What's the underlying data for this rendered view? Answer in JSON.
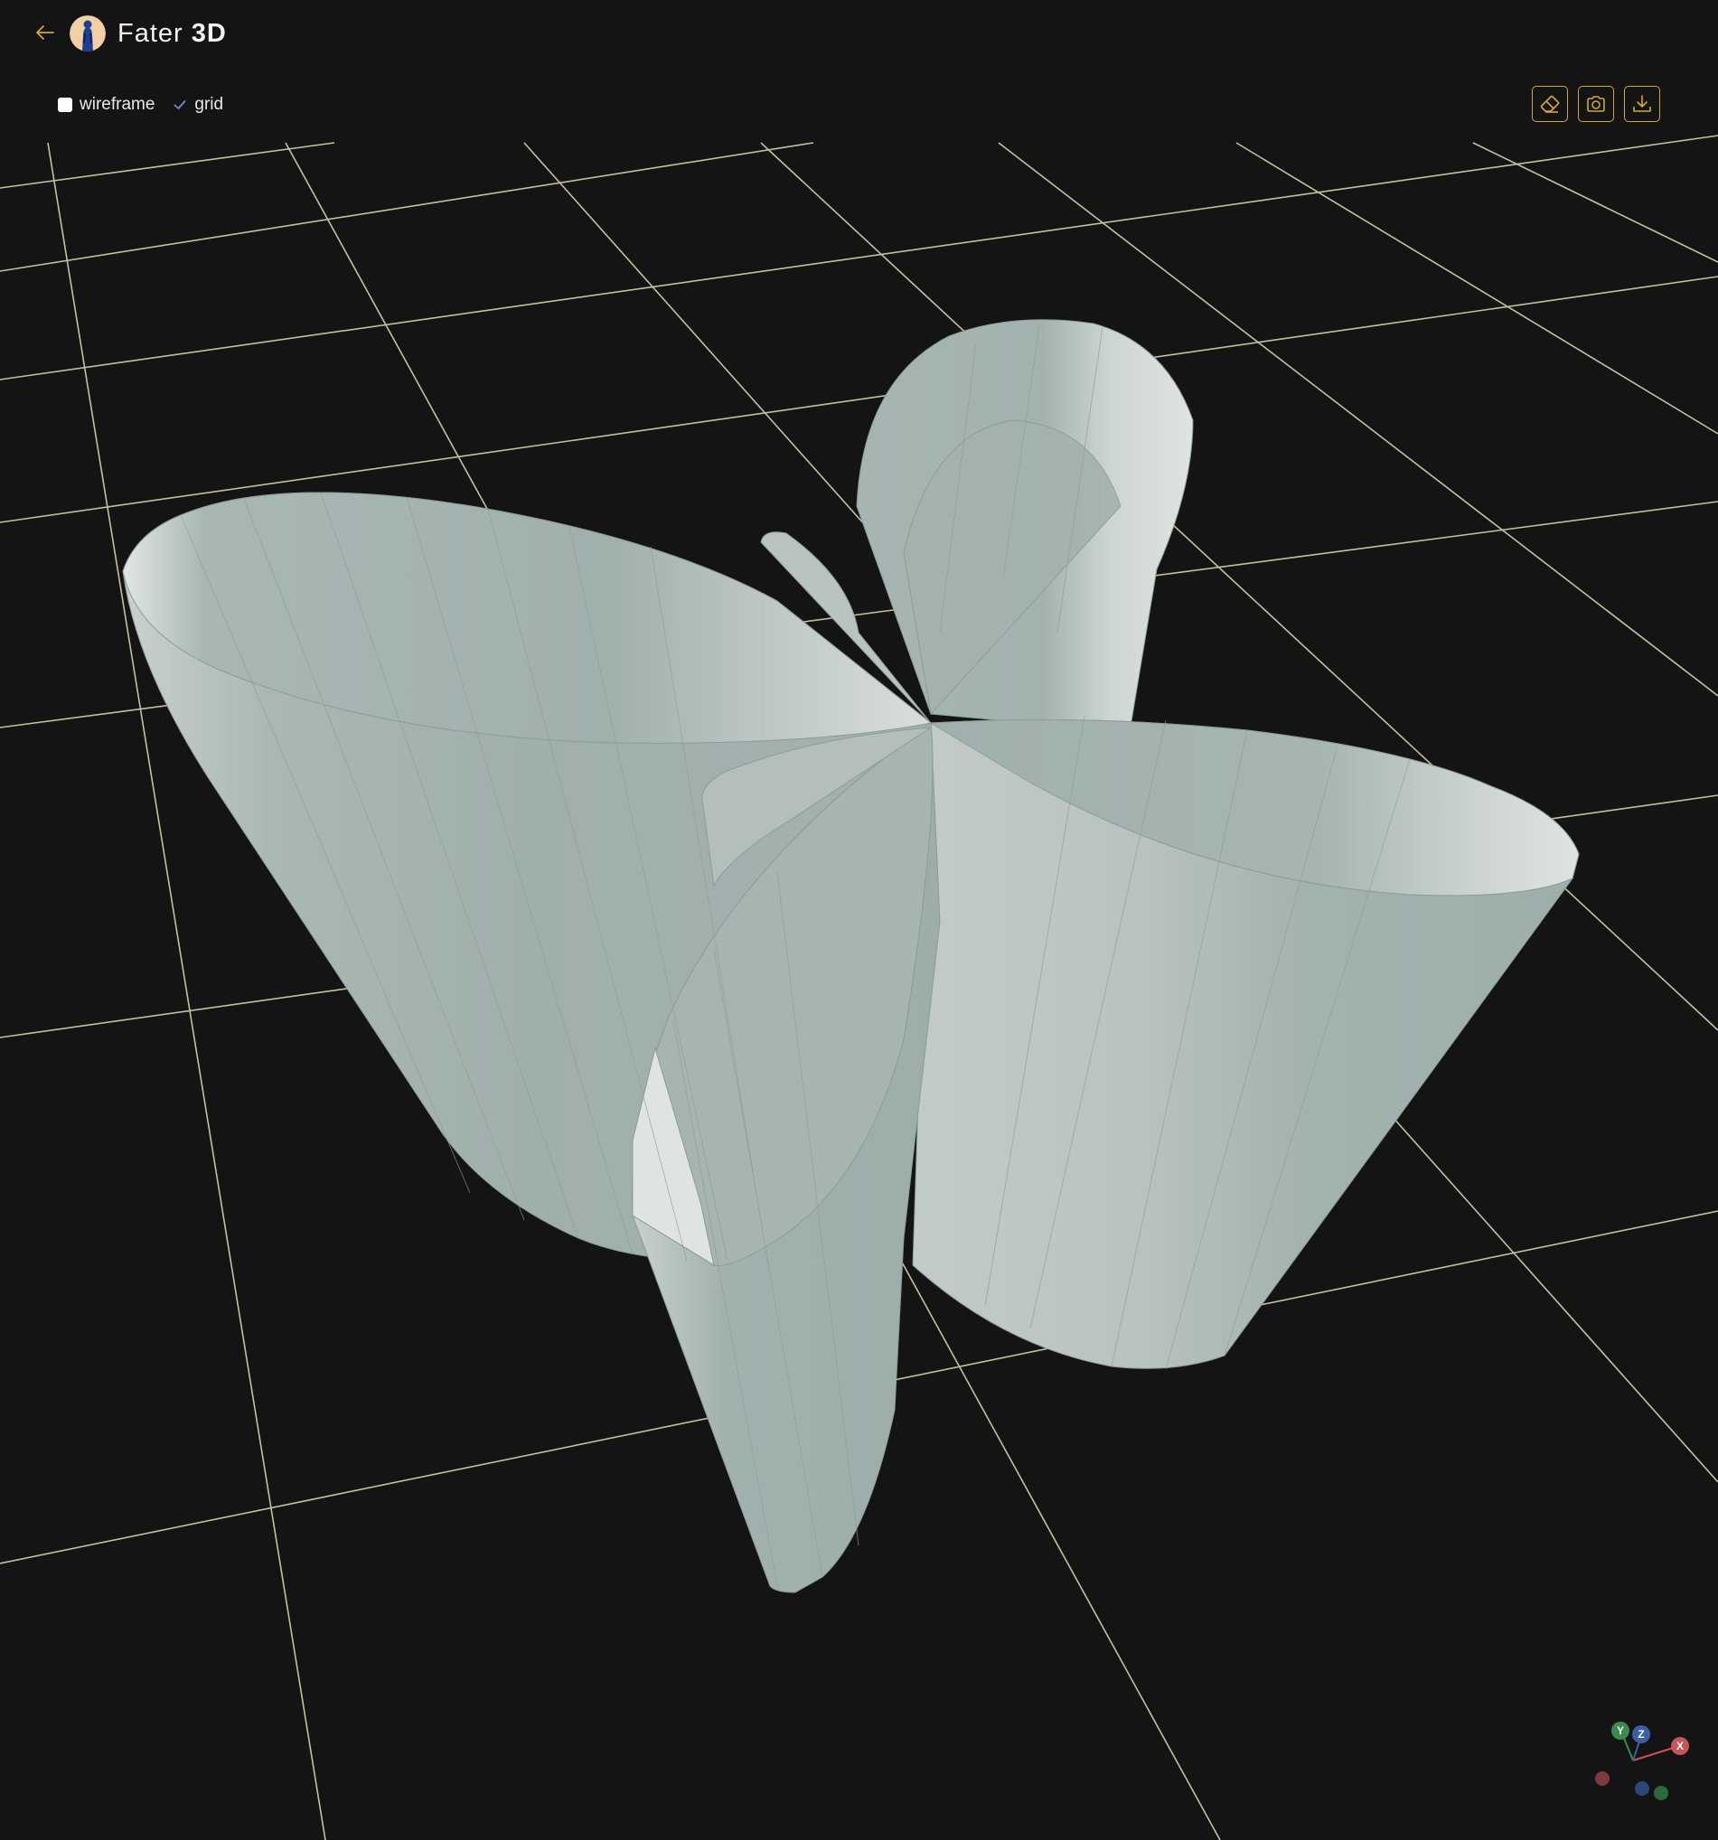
{
  "app": {
    "title_part1": "Fater",
    "title_part2": "3D",
    "back_icon": "arrow-left-icon",
    "accent_color": "#d2a73b"
  },
  "toggles": {
    "wireframe": {
      "label": "wireframe",
      "checked": false
    },
    "grid": {
      "label": "grid",
      "checked": true
    }
  },
  "actions": [
    {
      "name": "eraser-button",
      "icon": "eraser-icon"
    },
    {
      "name": "screenshot-button",
      "icon": "camera-icon"
    },
    {
      "name": "download-button",
      "icon": "download-icon"
    }
  ],
  "gizmo": {
    "x_label": "X",
    "y_label": "Y",
    "z_label": "Z",
    "x_color": "#c6545a",
    "y_color": "#3d8a4d",
    "z_color": "#3b5fa3"
  },
  "scene": {
    "background": "#141414",
    "grid_color": "#d8d4b0",
    "mesh_color": "#a0b0ad",
    "mesh_light_color": "#d7ddd9"
  }
}
